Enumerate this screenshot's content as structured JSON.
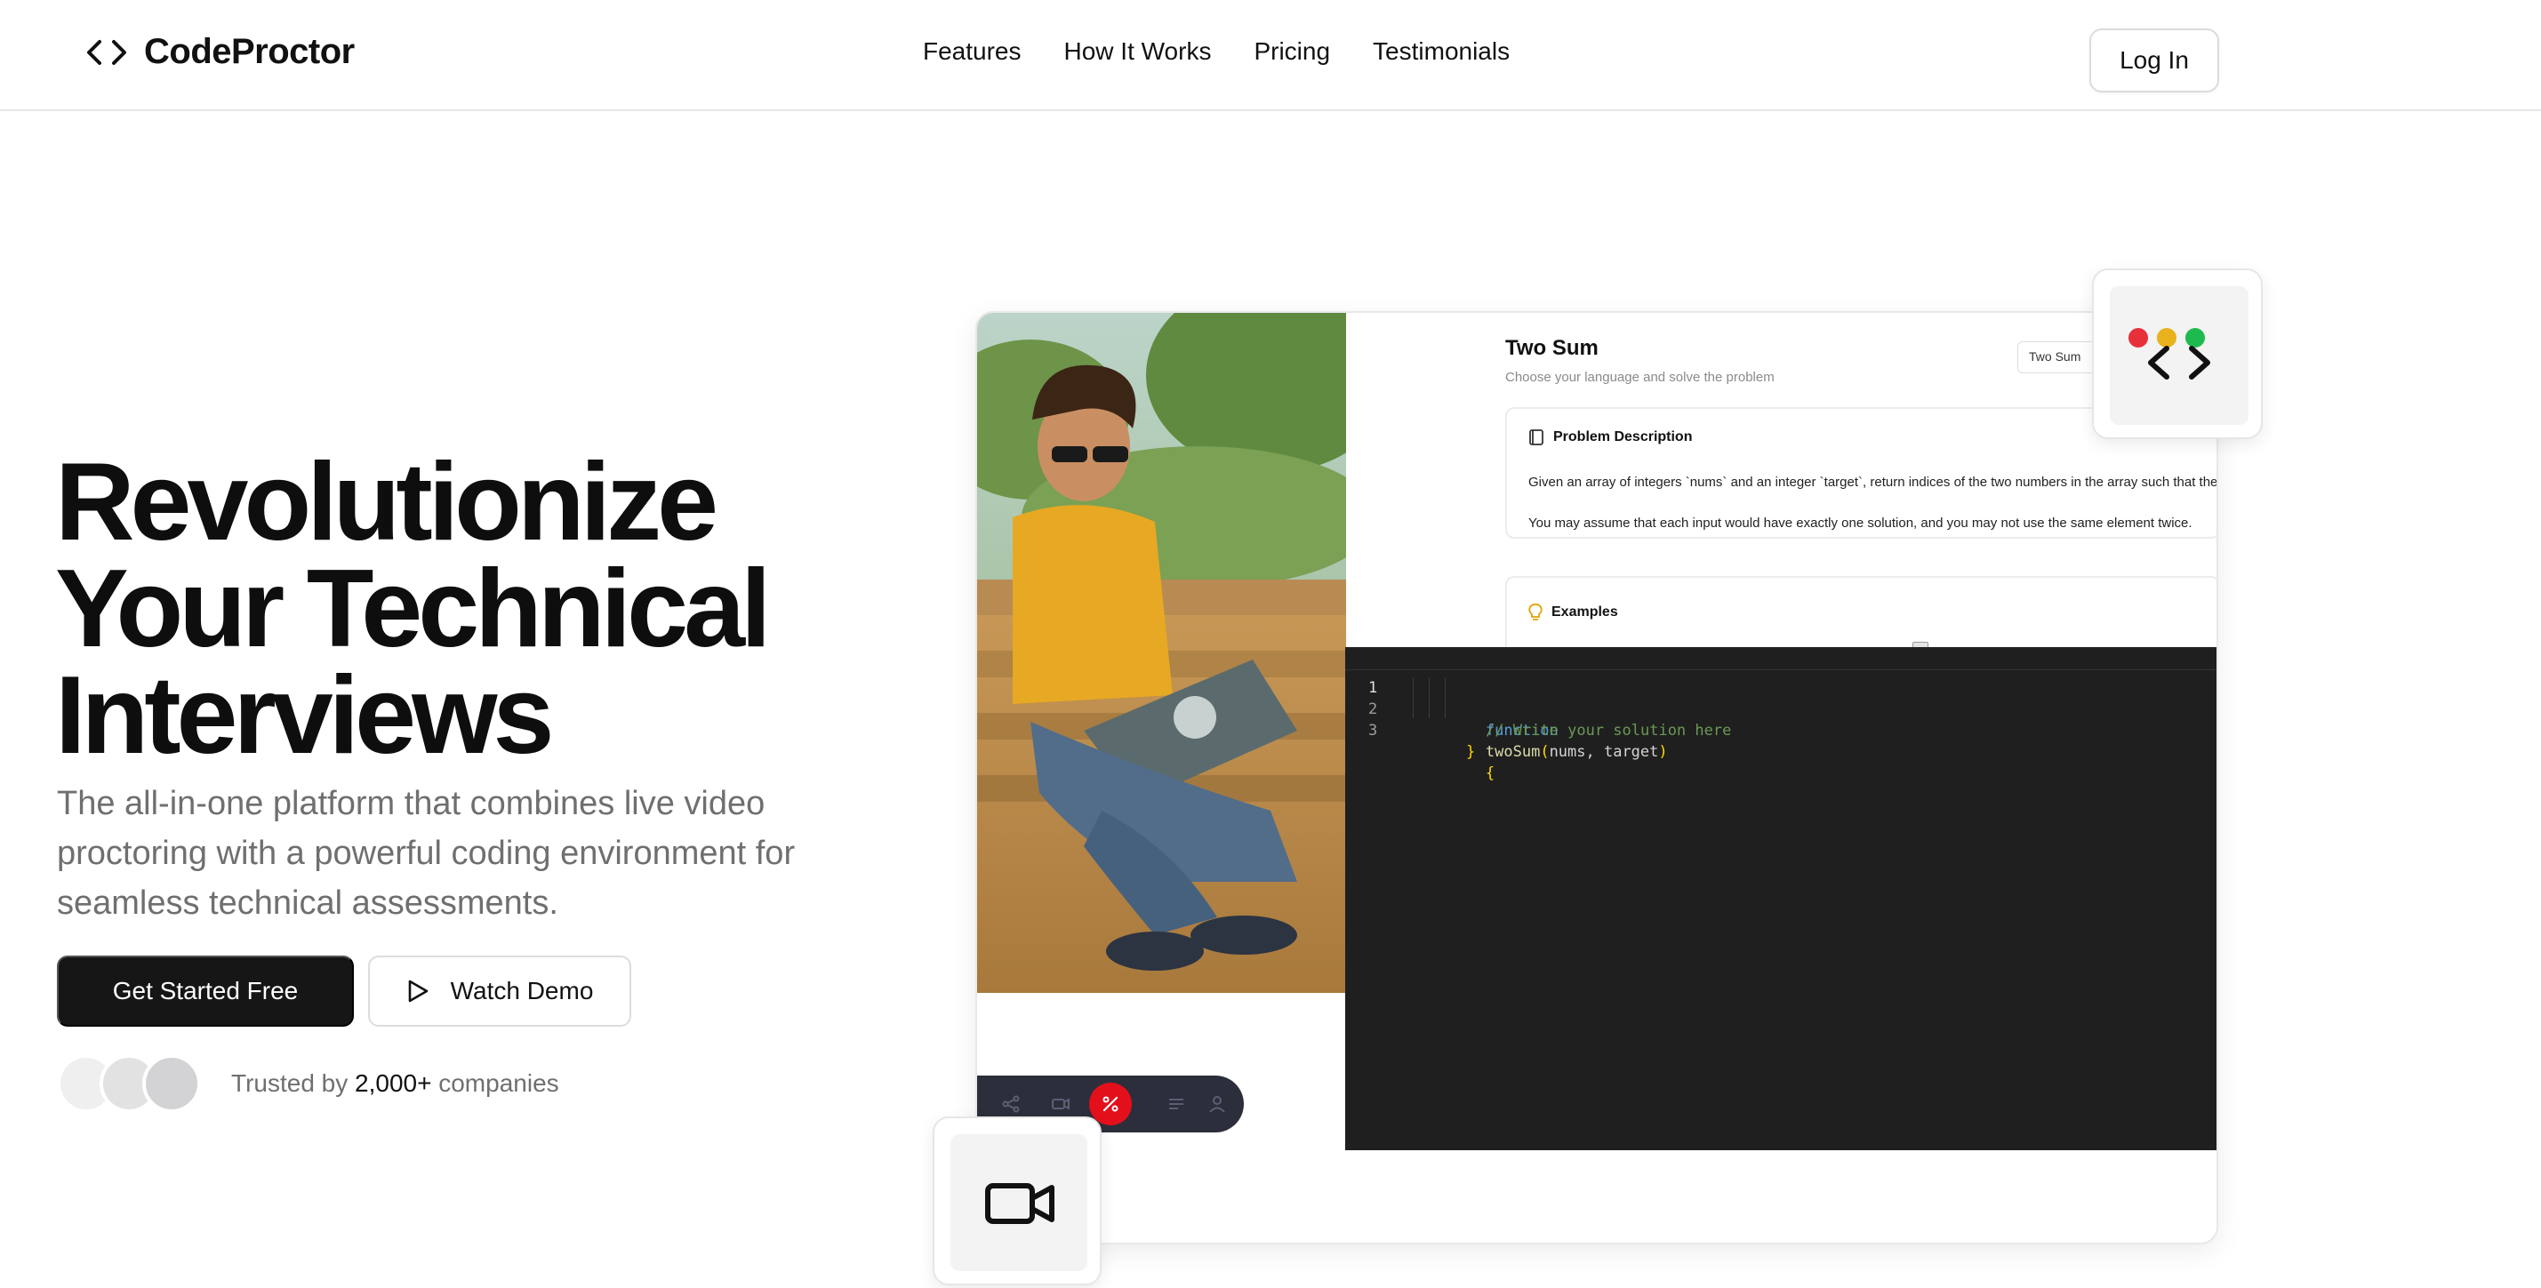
{
  "brand": {
    "name": "CodeProctor",
    "logo_icon": "code-brackets-icon"
  },
  "nav": {
    "links": [
      "Features",
      "How It Works",
      "Pricing",
      "Testimonials"
    ],
    "login_label": "Log In"
  },
  "hero": {
    "title_lines": [
      "Revolutionize",
      "Your Technical",
      "Interviews"
    ],
    "subtitle": "The all-in-one platform that combines live video proctoring with a powerful coding environment for seamless technical assessments.",
    "primary_cta": "Get Started Free",
    "secondary_cta": "Watch Demo",
    "secondary_cta_icon": "play-icon",
    "trusted_prefix": "Trusted by",
    "trusted_count": "2,000+",
    "trusted_suffix": "companies"
  },
  "mockup": {
    "problem_title": "Two Sum",
    "problem_subtitle": "Choose your language and solve the problem",
    "problem_select_value": "Two Sum",
    "description_heading": "Problem Description",
    "description_line1": "Given an array of integers `nums` and an integer `target`, return indices of the two numbers in the array such that they add up to `target`.",
    "description_line2": "You may assume that each input would have exactly one solution, and you may not use the same element twice.",
    "examples_heading": "Examples",
    "code": {
      "line_numbers": [
        "1",
        "2",
        "3"
      ],
      "keyword": "function",
      "function_name": "twoSum",
      "params_open": "(",
      "params": "nums, target",
      "params_close": ")",
      "brace_open": "{",
      "comment": "// Write your solution here",
      "brace_close": "}"
    },
    "controls": [
      "share-icon",
      "camera-icon",
      "end-call-icon",
      "chat-icon",
      "user-icon"
    ]
  },
  "floating_cards": {
    "code_card_icon": "code-window-icon",
    "video_card_icon": "video-camera-icon"
  },
  "colors": {
    "primary_button": "#161616",
    "editor_bg": "#1f1f1f",
    "end_call": "#e3101b",
    "dot_red": "#e8303a",
    "dot_yellow": "#e9b11b",
    "dot_green": "#1fba4f"
  }
}
